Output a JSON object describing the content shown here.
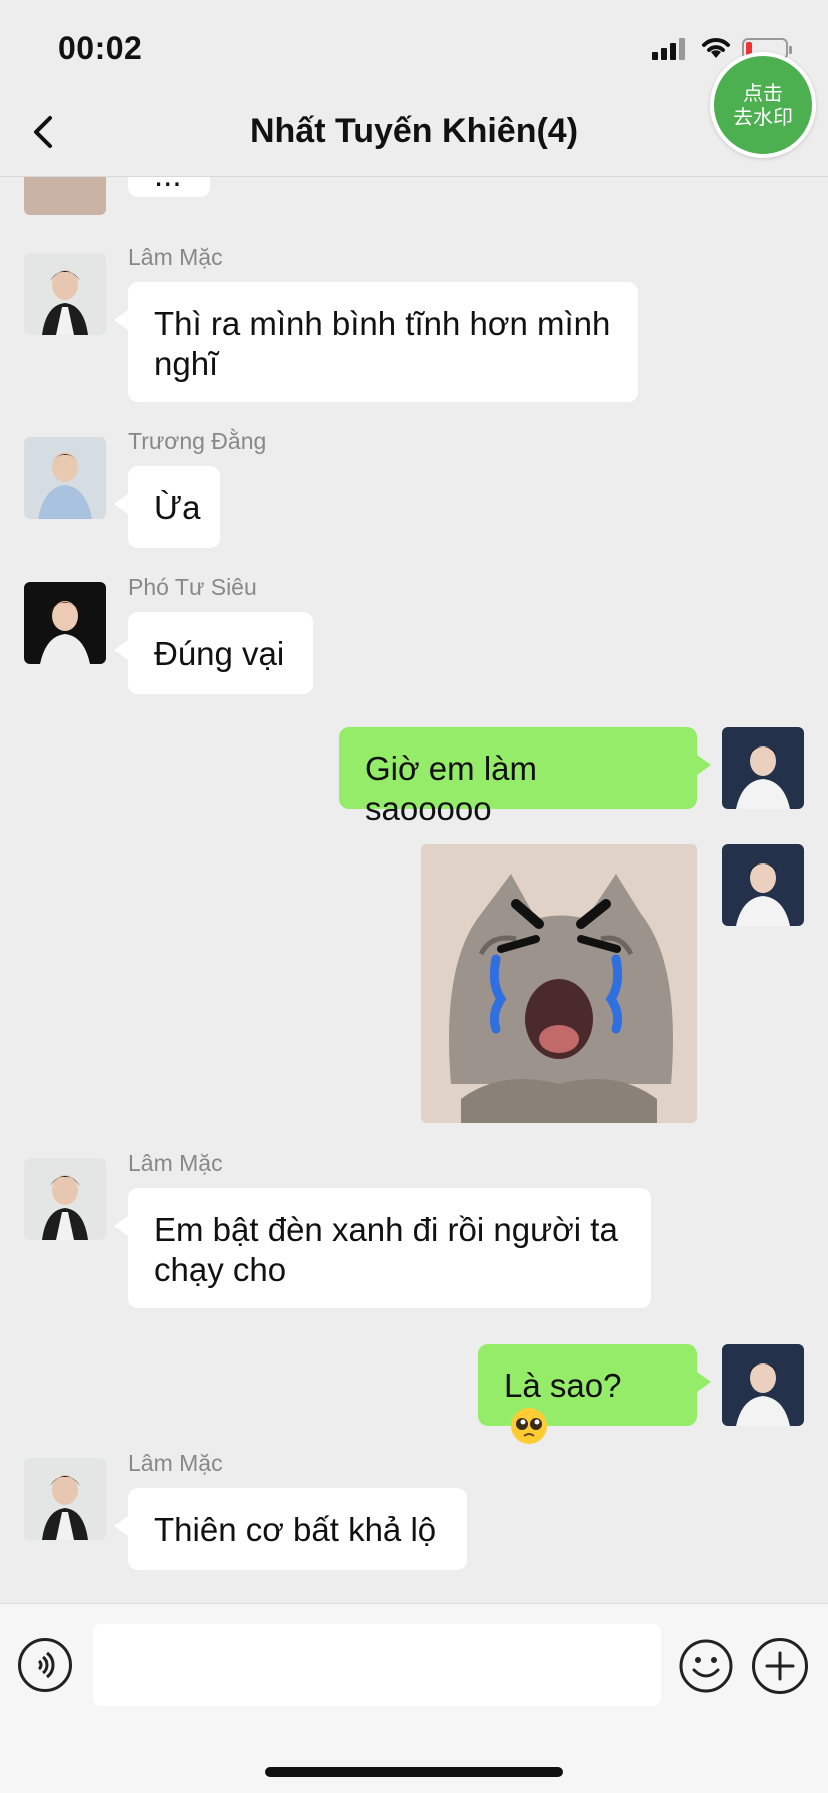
{
  "status_bar": {
    "time": "00:02"
  },
  "header": {
    "title": "Nhất Tuyến Khiên(4)",
    "back_icon": "chevron-left-icon"
  },
  "watermark_button": {
    "line1": "点击",
    "line2": "去水印"
  },
  "messages": [
    {
      "direction": "in",
      "text": "..."
    },
    {
      "direction": "in",
      "sender": "Lâm Mặc",
      "text": "Thì ra mình bình tĩnh hơn mình nghĩ"
    },
    {
      "direction": "in",
      "sender": "Trương Đằng",
      "text": "Ừa"
    },
    {
      "direction": "in",
      "sender": "Phó Tư Siêu",
      "text": "Đúng vại"
    },
    {
      "direction": "out",
      "text": "Giờ em làm saooooo"
    },
    {
      "direction": "out",
      "type": "sticker",
      "sticker": "crying-cat-sticker"
    },
    {
      "direction": "in",
      "sender": "Lâm Mặc",
      "text": "Em bật đèn xanh đi rồi người ta chạy cho"
    },
    {
      "direction": "out",
      "text": "Là sao?",
      "emoji": "pleading-face-emoji"
    },
    {
      "direction": "in",
      "sender": "Lâm Mặc",
      "text": "Thiên cơ bất khả lộ"
    }
  ],
  "input_bar": {
    "voice_icon": "voice-icon",
    "emoji_icon": "smiley-icon",
    "plus_icon": "plus-icon",
    "text_value": ""
  },
  "colors": {
    "background": "#ededed",
    "outgoing_bubble": "#95ec69",
    "incoming_bubble": "#ffffff",
    "watermark_button": "#4caf50"
  }
}
